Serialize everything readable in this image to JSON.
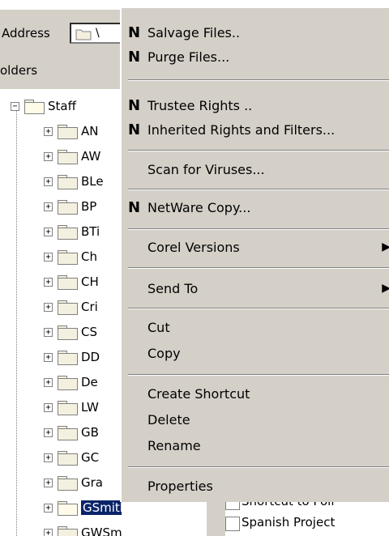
{
  "address": {
    "label": "Address",
    "value": "\\"
  },
  "folders_header": "olders",
  "tree": {
    "root": {
      "label": "Staff"
    },
    "children": [
      "AN",
      "AW",
      "BLe",
      "BP",
      "BTi",
      "Ch",
      "CH",
      "Cri",
      "CS",
      "DD",
      "De",
      "LW",
      "GB",
      "GC",
      "Gra",
      "GSmith",
      "GWSmith"
    ]
  },
  "context_menu": {
    "items": [
      {
        "label": "Salvage Files..",
        "netware": true
      },
      {
        "label": "Purge Files...",
        "netware": true
      },
      {
        "label": "Trustee Rights ..",
        "netware": true
      },
      {
        "label": "Inherited Rights and Filters...",
        "netware": true
      },
      {
        "label": "Scan for Viruses..."
      },
      {
        "label": "NetWare Copy...",
        "netware": true
      },
      {
        "label": "Corel Versions",
        "submenu": true
      },
      {
        "label": "Send To",
        "submenu": true
      },
      {
        "label": "Cut"
      },
      {
        "label": "Copy"
      },
      {
        "label": "Create Shortcut"
      },
      {
        "label": "Delete"
      },
      {
        "label": "Rename"
      },
      {
        "label": "Properties"
      }
    ],
    "netware_icon": "N"
  },
  "right_panel": {
    "items": [
      "Shortcut to Poli",
      "Spanish Project"
    ]
  }
}
